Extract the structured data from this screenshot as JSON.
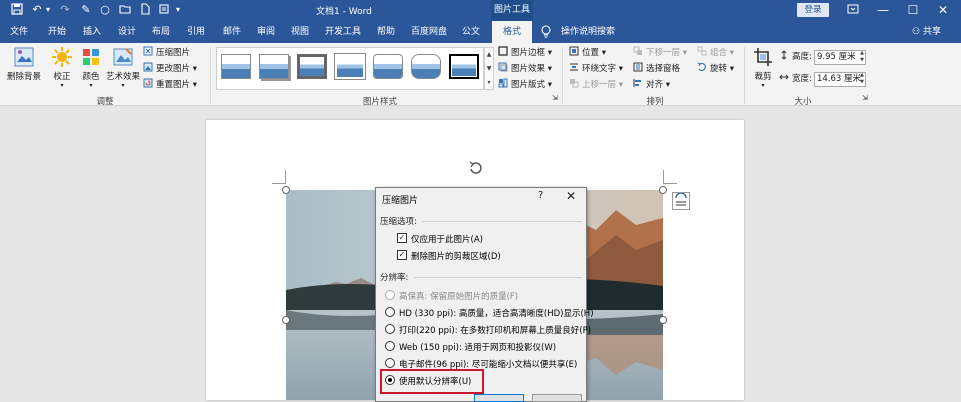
{
  "titlebar": {
    "doc_title": "文档1 - Word",
    "picture_tools": "图片工具",
    "login": "登录",
    "controls": [
      "ribbon-display-icon",
      "minimize-icon",
      "maximize-icon",
      "close-icon"
    ]
  },
  "tabs": {
    "file": "文件",
    "home": "开始",
    "insert": "插入",
    "design": "设计",
    "layout": "布局",
    "references": "引用",
    "mailings": "邮件",
    "review": "审阅",
    "view": "视图",
    "developer": "开发工具",
    "help": "帮助",
    "baidu": "百度网盘",
    "gongwen": "公文",
    "format": "格式",
    "tell_me": "操作说明搜索",
    "share": "共享"
  },
  "ribbon": {
    "adjust": {
      "remove_background": "删除背景",
      "corrections": "校正",
      "color": "颜色",
      "artistic": "艺术效果",
      "compress": "压缩图片",
      "change": "更改图片",
      "reset": "重置图片",
      "label": "调整"
    },
    "styles": {
      "border": "图片边框",
      "effects": "图片效果",
      "layout": "图片版式",
      "label": "图片样式"
    },
    "arrange": {
      "position": "位置",
      "wrap_text": "环绕文字",
      "bring_forward": "上移一层",
      "send_backward": "下移一层",
      "selection_pane": "选择窗格",
      "align": "对齐",
      "group": "组合",
      "rotate": "旋转",
      "label": "排列"
    },
    "size": {
      "crop": "裁剪",
      "height_label": "高度:",
      "height_value": "9.95 厘米",
      "width_label": "宽度:",
      "width_value": "14.63 厘米",
      "label": "大小"
    }
  },
  "dialog": {
    "title": "压缩图片",
    "help": "?",
    "close": "✕",
    "options_label": "压缩选项:",
    "apply_only": "仅应用于此图片(A)",
    "delete_cropped": "删除图片的剪裁区域(D)",
    "resolution_label": "分辨率:",
    "resolutions": [
      "高保真: 保留原始图片的质量(F)",
      "HD (330 ppi): 高质量，适合高清晰度(HD)显示(H)",
      "打印(220 ppi): 在多数打印机和屏幕上质量良好(P)",
      "Web (150 ppi): 适用于网页和投影仪(W)",
      "电子邮件(96 ppi): 尽可能缩小文档以便共享(E)",
      "使用默认分辨率(U)"
    ],
    "selected_resolution": "使用默认分辨率(U)",
    "highlight_color": "#c8192e"
  }
}
